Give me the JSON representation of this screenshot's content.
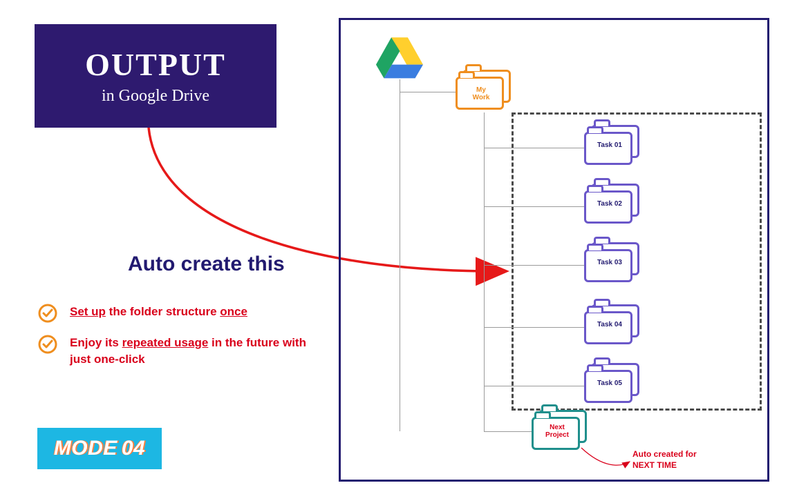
{
  "header": {
    "title": "OUTPUT",
    "subtitle": "in Google Drive"
  },
  "callout": {
    "title": "Auto create this"
  },
  "bullets": [
    {
      "pre": "Set up",
      "mid": " the folder structure ",
      "post": "once"
    },
    {
      "pre2": "Enjoy its ",
      "u": "repeated usage",
      "post2": " in the future with just one-click"
    }
  ],
  "badge": {
    "word": "MODE",
    "num": "04"
  },
  "tree": {
    "root_label": "My\nWork",
    "tasks": [
      "Task 01",
      "Task 02",
      "Task 03",
      "Task 04",
      "Task 05"
    ],
    "next_label": "Next\nProject",
    "note": "Auto created for\nNEXT TIME"
  },
  "colors": {
    "frame": "#221a70",
    "accent_orange": "#ef8e1f",
    "accent_purple": "#6a57c9",
    "accent_teal": "#1f8f8c",
    "red": "#d9001b",
    "blue_badge": "#1db7e3"
  }
}
